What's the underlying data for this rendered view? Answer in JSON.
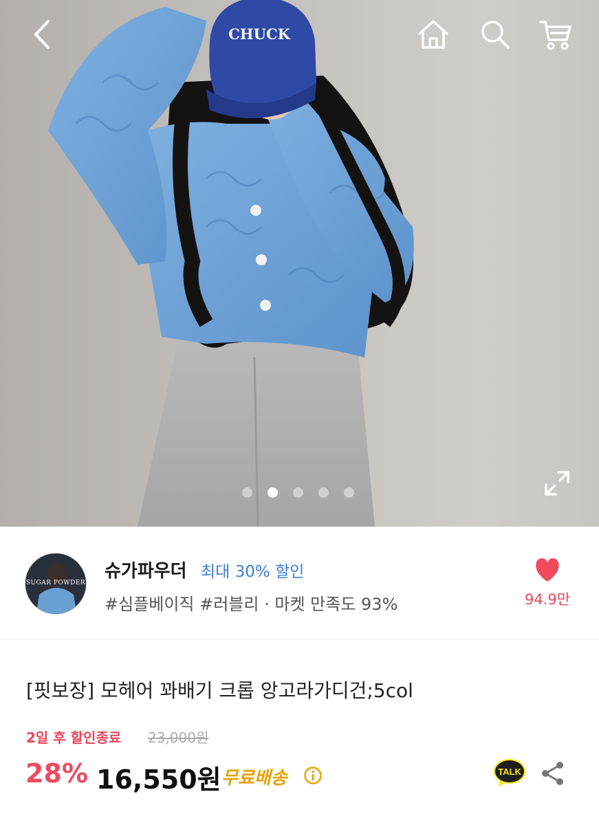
{
  "hero": {
    "cap_text": "CHUCK",
    "slides": {
      "count": 5,
      "active_index": 1
    },
    "icons": [
      "back-icon",
      "home-icon",
      "search-icon",
      "cart-icon",
      "expand-icon"
    ]
  },
  "seller": {
    "avatar_text": "SUGAR POWDER",
    "name": "슈가파우더",
    "discount": "최대 30% 할인",
    "tags": "#심플베이직 #러블리 · 마켓 만족도 93%",
    "likes": "94.9만"
  },
  "product": {
    "title": "[핏보장] 모헤어 꽈배기 크롭 앙고라가디건;5col",
    "sale_ends": "2일 후 할인종료",
    "original_price": "23,000원",
    "discount_rate": "28%",
    "sale_price": "16,550원",
    "free_shipping": "무료배송",
    "talk_label": "TALK"
  },
  "colors": {
    "accent_red": "#f04a5f",
    "discount_blue": "#3b7ed9",
    "shipping_orange": "#e8a100",
    "talk_yellow": "#fee500"
  }
}
